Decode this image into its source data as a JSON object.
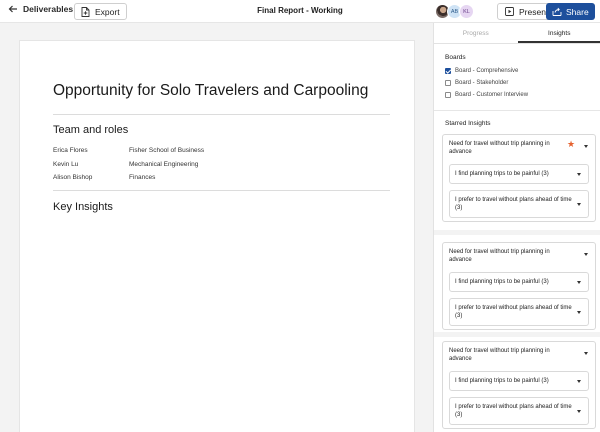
{
  "topbar": {
    "back_label": "Deliverables",
    "export_label": "Export",
    "title": "Final Report - Working",
    "avatars": [
      "AB",
      "KL"
    ],
    "present_label": "Present",
    "share_label": "Share"
  },
  "document": {
    "title": "Opportunity for Solo Travelers and Carpooling",
    "team_heading": "Team and roles",
    "members": [
      {
        "name": "Erica Flores",
        "role": "Fisher School of Business"
      },
      {
        "name": "Kevin Lu",
        "role": "Mechanical Engineering"
      },
      {
        "name": "Alison Bishop",
        "role": "Finances"
      }
    ],
    "insights_heading": "Key Insights"
  },
  "panel": {
    "tabs": [
      "Progress",
      "Insights"
    ],
    "active_tab": "Insights",
    "boards_label": "Boards",
    "boards": [
      {
        "label": "Board - Comprehensive",
        "checked": true
      },
      {
        "label": "Board - Stakeholder",
        "checked": false
      },
      {
        "label": "Board - Customer Interview",
        "checked": false
      }
    ],
    "starred_label": "Starred Insights",
    "insights": [
      {
        "title": "Need for travel without trip planning in advance",
        "starred": true,
        "items": [
          "I find planning trips to be painful (3)",
          "I prefer to travel without plans ahead of time (3)"
        ]
      },
      {
        "title": "Need for travel without trip planning in advance",
        "starred": false,
        "items": [
          "I find planning trips to be painful (3)",
          "I prefer to travel without plans ahead of time (3)"
        ]
      },
      {
        "title": "Need for travel without trip planning in advance",
        "starred": false,
        "items": [
          "I find planning trips to be painful (3)",
          "I prefer to travel without plans ahead of time (3)"
        ]
      }
    ]
  },
  "colors": {
    "accent": "#1d4f9c",
    "star": "#e5622f"
  }
}
